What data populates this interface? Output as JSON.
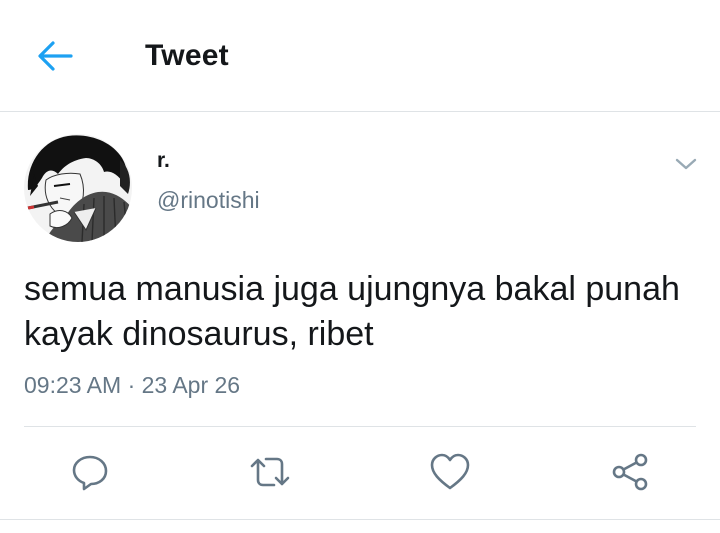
{
  "header": {
    "title": "Tweet",
    "back_icon": "arrow-left-icon",
    "accent_color": "#1da1f2"
  },
  "tweet": {
    "author": {
      "name": "r.",
      "handle": "@rinotishi",
      "avatar_icon": "avatar-manga-portrait"
    },
    "text": "semua manusia juga ujungnya bakal punah kayak dinosaurus, ribet",
    "meta": "09:23 AM · 23 Apr 26"
  },
  "actions": [
    {
      "name": "reply",
      "icon": "reply-icon"
    },
    {
      "name": "retweet",
      "icon": "retweet-icon"
    },
    {
      "name": "like",
      "icon": "heart-icon"
    },
    {
      "name": "share",
      "icon": "share-icon"
    }
  ],
  "colors": {
    "text_primary": "#14171a",
    "text_secondary": "#657786",
    "icon": "#657786",
    "divider": "#dfe3e6"
  }
}
